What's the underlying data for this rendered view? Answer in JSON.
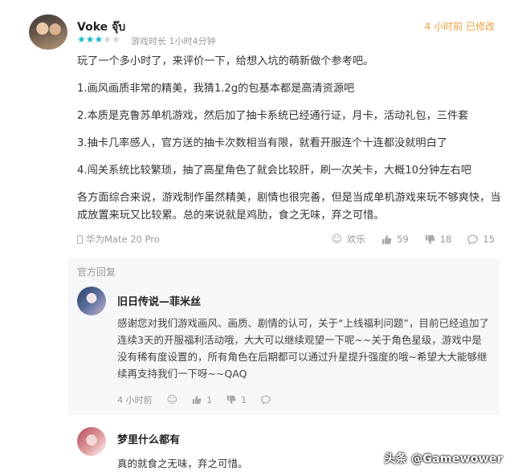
{
  "review": {
    "user_name": "Voke จุ๊บ",
    "rating": 3,
    "rating_max": 5,
    "playtime": "游戏时长 1小时4分钟",
    "meta_right": "4 小时前 已修改",
    "paragraphs": [
      "玩了一个多小时了，来评价一下，给想入坑的萌新做个参考吧。",
      "1.画风画质非常的精美，我猜1.2g的包基本都是高清资源吧",
      "2.本质是克鲁苏单机游戏，然后加了抽卡系统已经通行证，月卡，活动礼包，三件套",
      "3.抽卡几率感人，官方送的抽卡次数相当有限，就看开服连个十连都没就明白了",
      "4.闯关系统比较繁琐，抽了高星角色了就会比较肝，刷一次关卡，大概10分钟左右吧",
      "各方面综合来说，游戏制作虽然精美，剧情也很完善，但是当成单机游戏来玩不够爽快，当成放置来玩又比较累。总的来说就是鸡肋，食之无味，弃之可惜。"
    ],
    "device": "华为Mate 20 Pro",
    "reaction_label": "欢乐",
    "likes": "59",
    "dislikes": "18",
    "comments": "15"
  },
  "official_reply": {
    "section_title": "官方回复",
    "author": "旧日传说—菲米丝",
    "text": "感谢您对我们游戏画风、画质、剧情的认可，关于“上线福利问题”，目前已经追加了连续3天的开服福利活动哦，大大可以继续观望一下呢~~关于角色星级，游戏中是没有稀有度设置的，所有角色在后期都可以通过升星提升强度的哦~希望大大能够继续再支持我们一下呀~~QAQ",
    "time": "4 小时前",
    "likes": "1",
    "dislikes": "1"
  },
  "user_reply": {
    "author": "梦里什么都有",
    "text": "真的就食之无味，弃之可惜。"
  },
  "watermark": "头条 @Gamewower",
  "colors": {
    "star_on": "#14b9c8",
    "star_off": "#cfd3d6",
    "meta_orange": "#f0a040",
    "official_bg": "#f6f7f8"
  },
  "icons": {
    "device": "phone-icon",
    "reaction": "smile-icon",
    "like": "thumb-up-icon",
    "dislike": "thumb-down-icon",
    "comment": "comment-icon"
  }
}
